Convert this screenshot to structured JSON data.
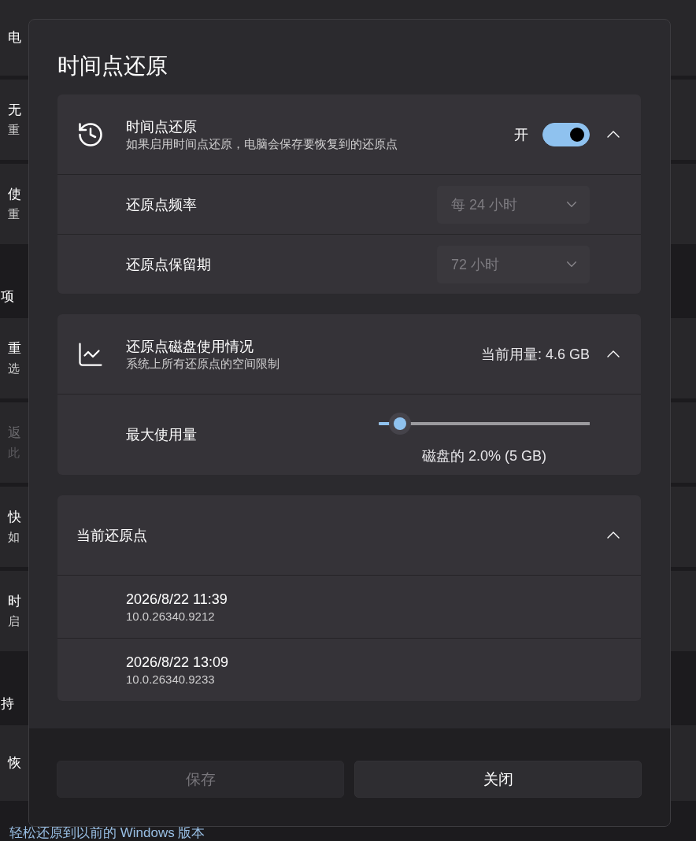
{
  "background_page": {
    "items": [
      {
        "kind": "card",
        "title": "电",
        "disabled": false
      },
      {
        "kind": "card",
        "title": "无",
        "subtitle": "重",
        "disabled": false
      },
      {
        "kind": "card",
        "title": "使",
        "subtitle": "重",
        "disabled": false
      },
      {
        "kind": "section",
        "title": "项",
        "disabled": false
      },
      {
        "kind": "card",
        "title": "重",
        "subtitle": "选",
        "disabled": false
      },
      {
        "kind": "card",
        "title": "返",
        "subtitle": "此",
        "disabled": true
      },
      {
        "kind": "card",
        "title": "快",
        "subtitle": "如",
        "disabled": false
      },
      {
        "kind": "card",
        "title": "时",
        "subtitle": "启",
        "disabled": false
      },
      {
        "kind": "section",
        "title": "持",
        "disabled": false
      },
      {
        "kind": "card",
        "title": "恢",
        "disabled": false
      }
    ],
    "link": "轻松还原到以前的 Windows 版本"
  },
  "dialog": {
    "title": "时间点还原",
    "sections": [
      {
        "kind": "toggle",
        "title": "时间点还原",
        "subtitle": "如果启用时间点还原，电脑会保存要恢复到的还原点",
        "toggle": {
          "label": "开",
          "on": true
        },
        "expanded": true,
        "rows": [
          {
            "kind": "dropdown",
            "label": "还原点频率",
            "dropdown": {
              "value": "每 24 小时",
              "disabled": true
            }
          },
          {
            "kind": "dropdown",
            "label": "还原点保留期",
            "dropdown": {
              "value": "72 小时",
              "disabled": true
            }
          }
        ]
      },
      {
        "kind": "usage",
        "title": "还原点磁盘使用情况",
        "subtitle": "系统上所有还原点的空间限制",
        "value": "当前用量: 4.6 GB",
        "expanded": true,
        "rows": [
          {
            "kind": "slider",
            "label": "最大使用量",
            "slider": {
              "level": 0.1,
              "caption": "磁盘的 2.0% (5 GB)"
            }
          }
        ]
      },
      {
        "kind": "list",
        "title": "当前还原点",
        "expanded": true,
        "items": [
          {
            "date": "2026/8/22 11:39",
            "version": "10.0.26340.9212"
          },
          {
            "date": "2026/8/22 13:09",
            "version": "10.0.26340.9233"
          }
        ]
      }
    ],
    "buttons": [
      {
        "label": "保存",
        "disabled": true
      },
      {
        "label": "关闭",
        "disabled": false
      }
    ]
  }
}
